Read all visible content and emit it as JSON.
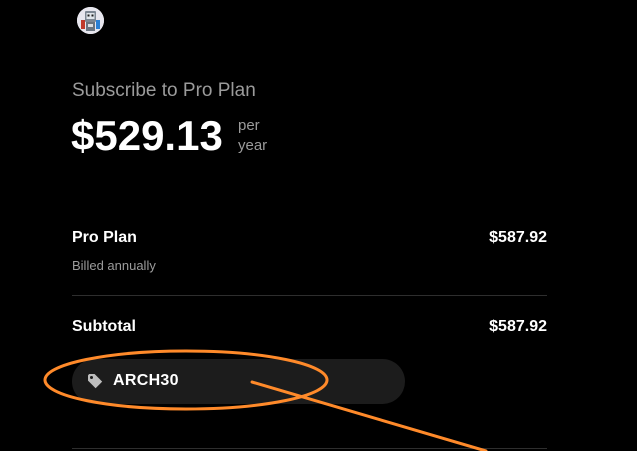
{
  "header": {
    "avatar_icon": "robot-avatar-icon"
  },
  "summary": {
    "title": "Subscribe to Pro Plan",
    "price": "$529.13",
    "per_label": "per",
    "period_label": "year"
  },
  "line_items": {
    "plan_name": "Pro Plan",
    "plan_price": "$587.92",
    "billing_note": "Billed annually"
  },
  "totals": {
    "subtotal_label": "Subtotal",
    "subtotal_value": "$587.92"
  },
  "promo": {
    "icon": "tag-icon",
    "code": "ARCH30"
  },
  "annotation": {
    "color": "#ff8a2a",
    "shape": "ellipse-with-arrow"
  },
  "colors": {
    "background": "#000000",
    "muted_text": "#9b9b9b",
    "chip_background": "#1c1c1c"
  }
}
